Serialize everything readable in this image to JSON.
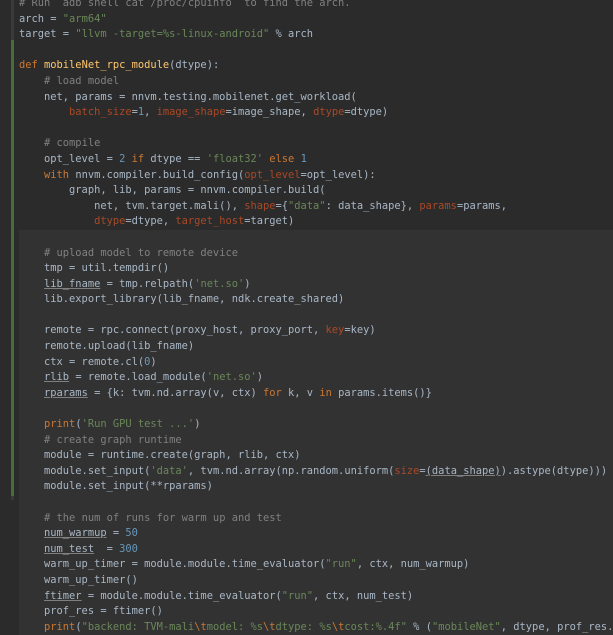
{
  "editor": {
    "lines": [
      [
        {
          "t": "# Run  adb shell cat /proc/cpuinfo  to find the arch.",
          "c": "cmt"
        }
      ],
      [
        {
          "t": "arch = "
        },
        {
          "t": "\"arm64\"",
          "c": "str"
        }
      ],
      [
        {
          "t": "target = "
        },
        {
          "t": "\"llvm -target=%s-linux-android\"",
          "c": "str"
        },
        {
          "t": " % arch"
        }
      ],
      [
        {
          "t": ""
        }
      ],
      [
        {
          "t": "def ",
          "c": "kw"
        },
        {
          "t": "mobileNet_rpc_module",
          "c": "fn"
        },
        {
          "t": "(dtype):"
        }
      ],
      [
        {
          "t": "    "
        },
        {
          "t": "# load model",
          "c": "cmt"
        }
      ],
      [
        {
          "t": "    net, params = nnvm.testing.mobilenet.get_workload("
        }
      ],
      [
        {
          "t": "        "
        },
        {
          "t": "batch_size",
          "c": "kwarg"
        },
        {
          "t": "="
        },
        {
          "t": "1",
          "c": "num"
        },
        {
          "t": ", "
        },
        {
          "t": "image_shape",
          "c": "kwarg"
        },
        {
          "t": "=image_shape, "
        },
        {
          "t": "dtype",
          "c": "kwarg"
        },
        {
          "t": "=dtype)"
        }
      ],
      [
        {
          "t": ""
        }
      ],
      [
        {
          "t": "    "
        },
        {
          "t": "# compile",
          "c": "cmt"
        }
      ],
      [
        {
          "t": "    opt_level = "
        },
        {
          "t": "2",
          "c": "num"
        },
        {
          "t": " "
        },
        {
          "t": "if",
          "c": "kw"
        },
        {
          "t": " dtype == "
        },
        {
          "t": "'float32'",
          "c": "str"
        },
        {
          "t": " "
        },
        {
          "t": "else",
          "c": "kw"
        },
        {
          "t": " "
        },
        {
          "t": "1",
          "c": "num"
        }
      ],
      [
        {
          "t": "    "
        },
        {
          "t": "with",
          "c": "kw"
        },
        {
          "t": " nnvm.compiler.build_config("
        },
        {
          "t": "opt_level",
          "c": "kwarg"
        },
        {
          "t": "=opt_level):"
        }
      ],
      [
        {
          "t": "        graph, lib, params = nnvm.compiler.build("
        }
      ],
      [
        {
          "t": "            net, tvm.target.mali(), "
        },
        {
          "t": "shape",
          "c": "kwarg"
        },
        {
          "t": "={"
        },
        {
          "t": "\"data\"",
          "c": "str"
        },
        {
          "t": ": data_shape}, "
        },
        {
          "t": "params",
          "c": "kwarg"
        },
        {
          "t": "=params,"
        }
      ],
      [
        {
          "t": "            "
        },
        {
          "t": "dtype",
          "c": "kwarg"
        },
        {
          "t": "=dtype, "
        },
        {
          "t": "target_host",
          "c": "kwarg"
        },
        {
          "t": "=target)"
        }
      ],
      [
        {
          "t": ""
        }
      ],
      [
        {
          "t": "    "
        },
        {
          "t": "# upload model to remote device",
          "c": "cmt"
        }
      ],
      [
        {
          "t": "    tmp = util.tempdir()"
        }
      ],
      [
        {
          "t": "    "
        },
        {
          "t": "lib_fname",
          "c": "under"
        },
        {
          "t": " = tmp.relpath("
        },
        {
          "t": "'net.so'",
          "c": "str"
        },
        {
          "t": ")"
        }
      ],
      [
        {
          "t": "    lib.export_library(lib_fname, ndk.create_shared)"
        }
      ],
      [
        {
          "t": ""
        }
      ],
      [
        {
          "t": "    remote = rpc.connect(proxy_host, proxy_port, "
        },
        {
          "t": "key",
          "c": "kwarg"
        },
        {
          "t": "=key)"
        }
      ],
      [
        {
          "t": "    remote.upload(lib_fname)"
        }
      ],
      [
        {
          "t": "    ctx = remote.cl("
        },
        {
          "t": "0",
          "c": "num"
        },
        {
          "t": ")"
        }
      ],
      [
        {
          "t": "    "
        },
        {
          "t": "rlib",
          "c": "under"
        },
        {
          "t": " = remote.load_module("
        },
        {
          "t": "'net.so'",
          "c": "str"
        },
        {
          "t": ")"
        }
      ],
      [
        {
          "t": "    "
        },
        {
          "t": "rparams",
          "c": "under"
        },
        {
          "t": " = {k: tvm.nd.array(v, ctx) "
        },
        {
          "t": "for",
          "c": "kw"
        },
        {
          "t": " k, v "
        },
        {
          "t": "in",
          "c": "kw"
        },
        {
          "t": " params.items()}"
        }
      ],
      [
        {
          "t": ""
        }
      ],
      [
        {
          "t": "    "
        },
        {
          "t": "print",
          "c": "kw"
        },
        {
          "t": "("
        },
        {
          "t": "'Run GPU test ...'",
          "c": "str"
        },
        {
          "t": ")"
        }
      ],
      [
        {
          "t": "    "
        },
        {
          "t": "# create graph runtime",
          "c": "cmt"
        }
      ],
      [
        {
          "t": "    module = runtime.create(graph, rlib, ctx)"
        }
      ],
      [
        {
          "t": "    module.set_input("
        },
        {
          "t": "'data'",
          "c": "str"
        },
        {
          "t": ", tvm.nd.array(np.random.uniform("
        },
        {
          "t": "size",
          "c": "kwarg"
        },
        {
          "t": "="
        },
        {
          "t": "(data_shape)",
          "c": "under"
        },
        {
          "t": ").astype(dtype)))"
        }
      ],
      [
        {
          "t": "    module.set_input(**rparams)"
        }
      ],
      [
        {
          "t": ""
        }
      ],
      [
        {
          "t": "    "
        },
        {
          "t": "# the num of runs for warm up and test",
          "c": "cmt"
        }
      ],
      [
        {
          "t": "    "
        },
        {
          "t": "num_warmup",
          "c": "under"
        },
        {
          "t": " = "
        },
        {
          "t": "50",
          "c": "num"
        }
      ],
      [
        {
          "t": "    "
        },
        {
          "t": "num_test",
          "c": "under"
        },
        {
          "t": "  = "
        },
        {
          "t": "300",
          "c": "num"
        }
      ],
      [
        {
          "t": "    warm_up_timer = module.module.time_evaluator("
        },
        {
          "t": "\"run\"",
          "c": "str"
        },
        {
          "t": ", ctx, num_warmup)"
        }
      ],
      [
        {
          "t": "    warm_up_timer()"
        }
      ],
      [
        {
          "t": "    "
        },
        {
          "t": "ftimer",
          "c": "under"
        },
        {
          "t": " = module.module.time_evaluator("
        },
        {
          "t": "\"run\"",
          "c": "str"
        },
        {
          "t": ", ctx, num_test)"
        }
      ],
      [
        {
          "t": "    prof_res = ftimer()"
        }
      ],
      [
        {
          "t": "    "
        },
        {
          "t": "print",
          "c": "kw"
        },
        {
          "t": "("
        },
        {
          "t": "\"backend: TVM-mali",
          "c": "str"
        },
        {
          "t": "\\t",
          "c": "esc"
        },
        {
          "t": "model: %s",
          "c": "str"
        },
        {
          "t": "\\t",
          "c": "esc"
        },
        {
          "t": "dtype: %s",
          "c": "str"
        },
        {
          "t": "\\t",
          "c": "esc"
        },
        {
          "t": "cost:%.4f\"",
          "c": "str"
        },
        {
          "t": " % ("
        },
        {
          "t": "\"mobileNet\"",
          "c": "str"
        },
        {
          "t": ", dtype, prof_res.mean))"
        }
      ]
    ]
  }
}
